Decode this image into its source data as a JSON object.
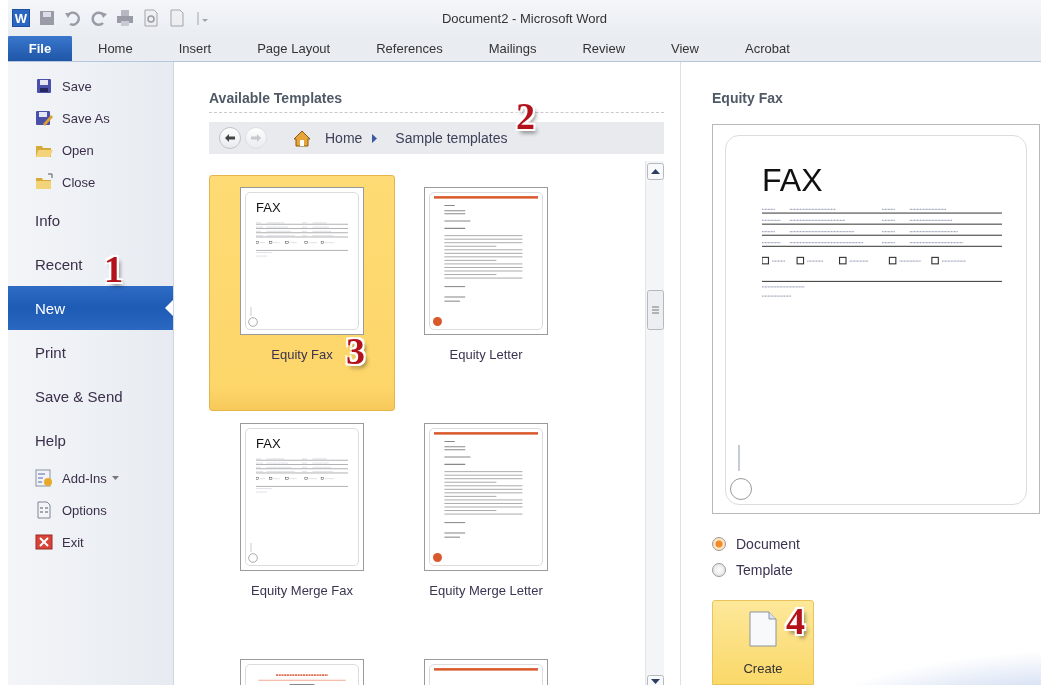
{
  "window": {
    "app_letter": "W",
    "title": "Document2 - Microsoft Word"
  },
  "ribbon_tabs": [
    {
      "label": "File",
      "selected": true
    },
    {
      "label": "Home",
      "selected": false
    },
    {
      "label": "Insert",
      "selected": false
    },
    {
      "label": "Page Layout",
      "selected": false
    },
    {
      "label": "References",
      "selected": false
    },
    {
      "label": "Mailings",
      "selected": false
    },
    {
      "label": "Review",
      "selected": false
    },
    {
      "label": "View",
      "selected": false
    },
    {
      "label": "Acrobat",
      "selected": false
    }
  ],
  "backstage_nav": [
    {
      "label": "Save",
      "kind": "save",
      "selected": false
    },
    {
      "label": "Save As",
      "kind": "save_as",
      "selected": false
    },
    {
      "label": "Open",
      "kind": "open",
      "selected": false
    },
    {
      "label": "Close",
      "kind": "close",
      "selected": false
    },
    {
      "label": "Info",
      "kind": "section",
      "selected": false
    },
    {
      "label": "Recent",
      "kind": "section",
      "selected": false
    },
    {
      "label": "New",
      "kind": "section",
      "selected": true
    },
    {
      "label": "Print",
      "kind": "section",
      "selected": false
    },
    {
      "label": "Save & Send",
      "kind": "section",
      "selected": false
    },
    {
      "label": "Help",
      "kind": "section",
      "selected": false
    },
    {
      "label": "Add-Ins",
      "kind": "add_ins",
      "selected": false
    },
    {
      "label": "Options",
      "kind": "options",
      "selected": false
    },
    {
      "label": "Exit",
      "kind": "exit",
      "selected": false
    }
  ],
  "available_templates": {
    "heading": "Available Templates",
    "nav_buttons": [
      {
        "kind": "back",
        "disabled": false
      },
      {
        "kind": "forward",
        "disabled": true
      }
    ],
    "breadcrumb": [
      "Home",
      "Sample templates"
    ],
    "templates": [
      {
        "name": "Equity Fax",
        "kind": "fax",
        "heading": "FAX",
        "selected": true
      },
      {
        "name": "Equity Letter",
        "kind": "letter",
        "selected": false
      },
      {
        "name": "Equity Merge Fax",
        "kind": "fax",
        "heading": "FAX",
        "selected": false
      },
      {
        "name": "Equity Merge Letter",
        "kind": "letter",
        "selected": false
      },
      {
        "kind": "report",
        "selected": false
      },
      {
        "kind": "letter",
        "selected": false
      }
    ]
  },
  "preview": {
    "title": "Equity Fax",
    "heading": "FAX",
    "create_as": [
      {
        "label": "Document",
        "selected": true
      },
      {
        "label": "Template",
        "selected": false
      }
    ],
    "create_button": "Create"
  },
  "callouts": [
    "1",
    "2",
    "3",
    "4"
  ]
}
